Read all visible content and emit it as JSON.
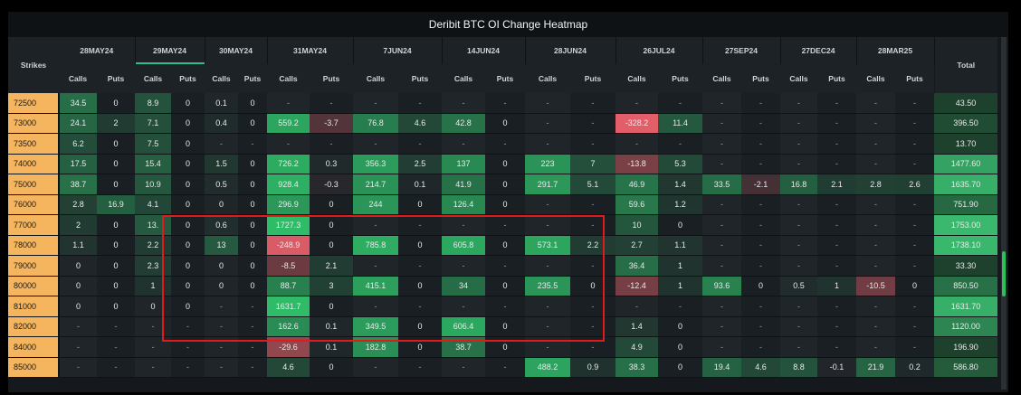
{
  "title": "Deribit BTC OI Change Heatmap",
  "headers": {
    "strikes": "Strikes",
    "total": "Total",
    "calls": "Calls",
    "puts": "Puts"
  },
  "expiries": [
    "28MAY24",
    "29MAY24",
    "30MAY24",
    "31MAY24",
    "7JUN24",
    "14JUN24",
    "28JUN24",
    "26JUL24",
    "27SEP24",
    "27DEC24",
    "28MAR25"
  ],
  "active_expiry_index": 1,
  "rows": [
    {
      "strike": "72500",
      "cells": [
        "34.5",
        "0",
        "8.9",
        "0",
        "0.1",
        "0",
        "-",
        "-",
        "-",
        "-",
        "-",
        "-",
        "-",
        "-",
        "-",
        "-",
        "-",
        "-",
        "-",
        "-",
        "-",
        "-"
      ],
      "total": "43.50"
    },
    {
      "strike": "73000",
      "cells": [
        "24.1",
        "2",
        "7.1",
        "0",
        "0.4",
        "0",
        "559.2",
        "-3.7",
        "76.8",
        "4.6",
        "42.8",
        "0",
        "-",
        "-",
        "-328.2",
        "11.4",
        "-",
        "-",
        "-",
        "-",
        "-",
        "-"
      ],
      "total": "396.50"
    },
    {
      "strike": "73500",
      "cells": [
        "6.2",
        "0",
        "7.5",
        "0",
        "-",
        "-",
        "-",
        "-",
        "-",
        "-",
        "-",
        "-",
        "-",
        "-",
        "-",
        "-",
        "-",
        "-",
        "-",
        "-",
        "-",
        "-"
      ],
      "total": "13.70"
    },
    {
      "strike": "74000",
      "cells": [
        "17.5",
        "0",
        "15.4",
        "0",
        "1.5",
        "0",
        "726.2",
        "0.3",
        "356.3",
        "2.5",
        "137",
        "0",
        "223",
        "7",
        "-13.8",
        "5.3",
        "-",
        "-",
        "-",
        "-",
        "-",
        "-"
      ],
      "total": "1477.60"
    },
    {
      "strike": "75000",
      "cells": [
        "38.7",
        "0",
        "10.9",
        "0",
        "0.5",
        "0",
        "928.4",
        "-0.3",
        "214.7",
        "0.1",
        "41.9",
        "0",
        "291.7",
        "5.1",
        "46.9",
        "1.4",
        "33.5",
        "-2.1",
        "16.8",
        "2.1",
        "2.8",
        "2.6"
      ],
      "total": "1635.70"
    },
    {
      "strike": "76000",
      "cells": [
        "2.8",
        "16.9",
        "4.1",
        "0",
        "0",
        "0",
        "296.9",
        "0",
        "244",
        "0",
        "126.4",
        "0",
        "-",
        "-",
        "59.6",
        "1.2",
        "-",
        "-",
        "-",
        "-",
        "-",
        "-"
      ],
      "total": "751.90"
    },
    {
      "strike": "77000",
      "cells": [
        "2",
        "0",
        "13.",
        "0",
        "0.6",
        "0",
        "1727.3",
        "0",
        "-",
        "-",
        "-",
        "-",
        "-",
        "-",
        "10",
        "0",
        "-",
        "-",
        "-",
        "-",
        "-",
        "-"
      ],
      "total": "1753.00"
    },
    {
      "strike": "78000",
      "cells": [
        "1.1",
        "0",
        "2.2",
        "0",
        "13",
        "0",
        "-248.9",
        "0",
        "785.8",
        "0",
        "605.8",
        "0",
        "573.1",
        "2.2",
        "2.7",
        "1.1",
        "-",
        "-",
        "-",
        "-",
        "-",
        "-"
      ],
      "total": "1738.10"
    },
    {
      "strike": "79000",
      "cells": [
        "0",
        "0",
        "2.3",
        "0",
        "0",
        "0",
        "-8.5",
        "2.1",
        "-",
        "-",
        "-",
        "-",
        "-",
        "-",
        "36.4",
        "1",
        "-",
        "-",
        "-",
        "-",
        "-",
        "-"
      ],
      "total": "33.30"
    },
    {
      "strike": "80000",
      "cells": [
        "0",
        "0",
        "1",
        "0",
        "0",
        "0",
        "88.7",
        "3",
        "415.1",
        "0",
        "34",
        "0",
        "235.5",
        "0",
        "-12.4",
        "1",
        "93.6",
        "0",
        "0.5",
        "1",
        "-10.5",
        "0"
      ],
      "total": "850.50"
    },
    {
      "strike": "81000",
      "cells": [
        "0",
        "0",
        "0",
        "0",
        "-",
        "-",
        "1631.7",
        "0",
        "-",
        "-",
        "-",
        "-",
        "-",
        "-",
        "-",
        "-",
        "-",
        "-",
        "-",
        "-",
        "-",
        "-"
      ],
      "total": "1631.70"
    },
    {
      "strike": "82000",
      "cells": [
        "-",
        "-",
        "-",
        "-",
        "-",
        "-",
        "162.6",
        "0.1",
        "349.5",
        "0",
        "606.4",
        "0",
        "-",
        "-",
        "1.4",
        "0",
        "-",
        "-",
        "-",
        "-",
        "-",
        "-"
      ],
      "total": "1120.00"
    },
    {
      "strike": "84000",
      "cells": [
        "-",
        "-",
        "-",
        "-",
        "-",
        "-",
        "-29.6",
        "0.1",
        "182.8",
        "0",
        "38.7",
        "0",
        "-",
        "-",
        "4.9",
        "0",
        "-",
        "-",
        "-",
        "-",
        "-",
        "-"
      ],
      "total": "196.90"
    },
    {
      "strike": "85000",
      "cells": [
        "-",
        "-",
        "-",
        "-",
        "-",
        "-",
        "4.6",
        "0",
        "-",
        "-",
        "-",
        "-",
        "488.2",
        "0.9",
        "38.3",
        "0",
        "19.4",
        "4.6",
        "8.8",
        "-0.1",
        "21.9",
        "0.2"
      ],
      "total": "586.80"
    }
  ],
  "colors": {
    "strike_bg": "#f5b55e",
    "positive": "#2fbf6a",
    "negative": "#e8606a",
    "highlight_box": "#e11b1b",
    "scrollbar_thumb": "#2fbf5a"
  }
}
